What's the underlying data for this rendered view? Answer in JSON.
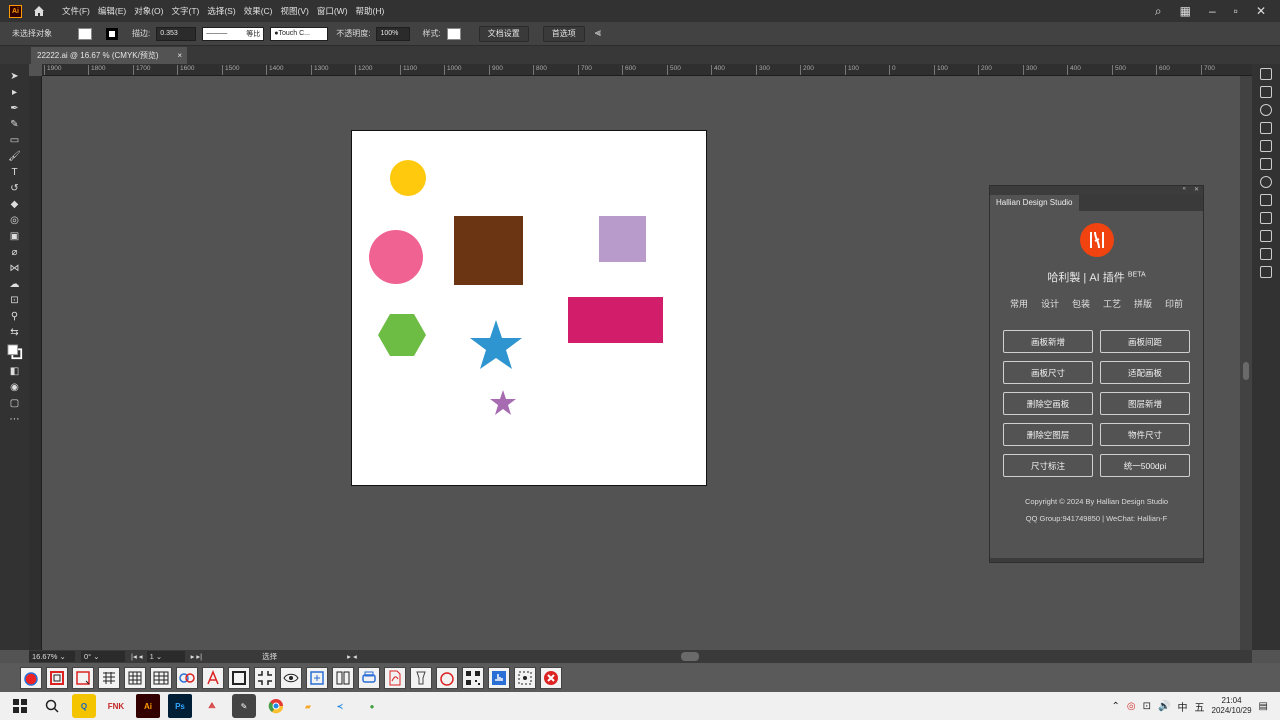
{
  "menubar": {
    "app_icon": "Ai",
    "menus": [
      "文件(F)",
      "编辑(E)",
      "对象(O)",
      "文字(T)",
      "选择(S)",
      "效果(C)",
      "视图(V)",
      "窗口(W)",
      "帮助(H)"
    ]
  },
  "controlbar": {
    "selection": "未选择对象",
    "stroke_label": "描边:",
    "stroke_value": "0.353",
    "stroke_style": "等比",
    "brush": "Touch C...",
    "opacity_label": "不透明度:",
    "opacity_value": "100%",
    "style_label": "样式:",
    "doc_setup": "文档设置",
    "preferences": "首选项"
  },
  "tab": {
    "title": "22222.ai @ 16.67 % (CMYK/预览)",
    "close": "×"
  },
  "ruler": [
    "1900",
    "1800",
    "1700",
    "1600",
    "1500",
    "1400",
    "1300",
    "1200",
    "1100",
    "1000",
    "900",
    "800",
    "700",
    "600",
    "500",
    "400",
    "300",
    "200",
    "100",
    "0",
    "100",
    "200",
    "300",
    "400",
    "500",
    "600",
    "700"
  ],
  "plugin": {
    "tab": "Hallian Design Studio",
    "title": "哈利製 | AI 插件",
    "beta": "BETA",
    "categories": [
      "常用",
      "设计",
      "包装",
      "工艺",
      "拼版",
      "印前"
    ],
    "buttons": [
      "画板新增",
      "画板间距",
      "画板尺寸",
      "适配画板",
      "删除空画板",
      "图层新增",
      "删除空图层",
      "物件尺寸",
      "尺寸标注",
      "统一500dpi"
    ],
    "copyright": "Copyright © 2024 By Hallian Design Studio",
    "contact": "QQ Group:941749850 | WeChat: Hallian-F"
  },
  "statusbar": {
    "zoom": "16.67%",
    "rotate": "0°",
    "page": "1",
    "mode": "选择"
  },
  "taskbar": {
    "time": "21:04",
    "date": "2024/10/29",
    "ime1": "中",
    "ime2": "五"
  },
  "colors": {
    "yellow": "#ffc90e",
    "pink": "#f06292",
    "brown": "#6b3513",
    "lilac": "#b99bcb",
    "magenta": "#d21e6a",
    "green": "#6dbd45",
    "blue": "#2e95d0",
    "purple": "#a66bb0",
    "plugin_logo": "#f0430f"
  }
}
